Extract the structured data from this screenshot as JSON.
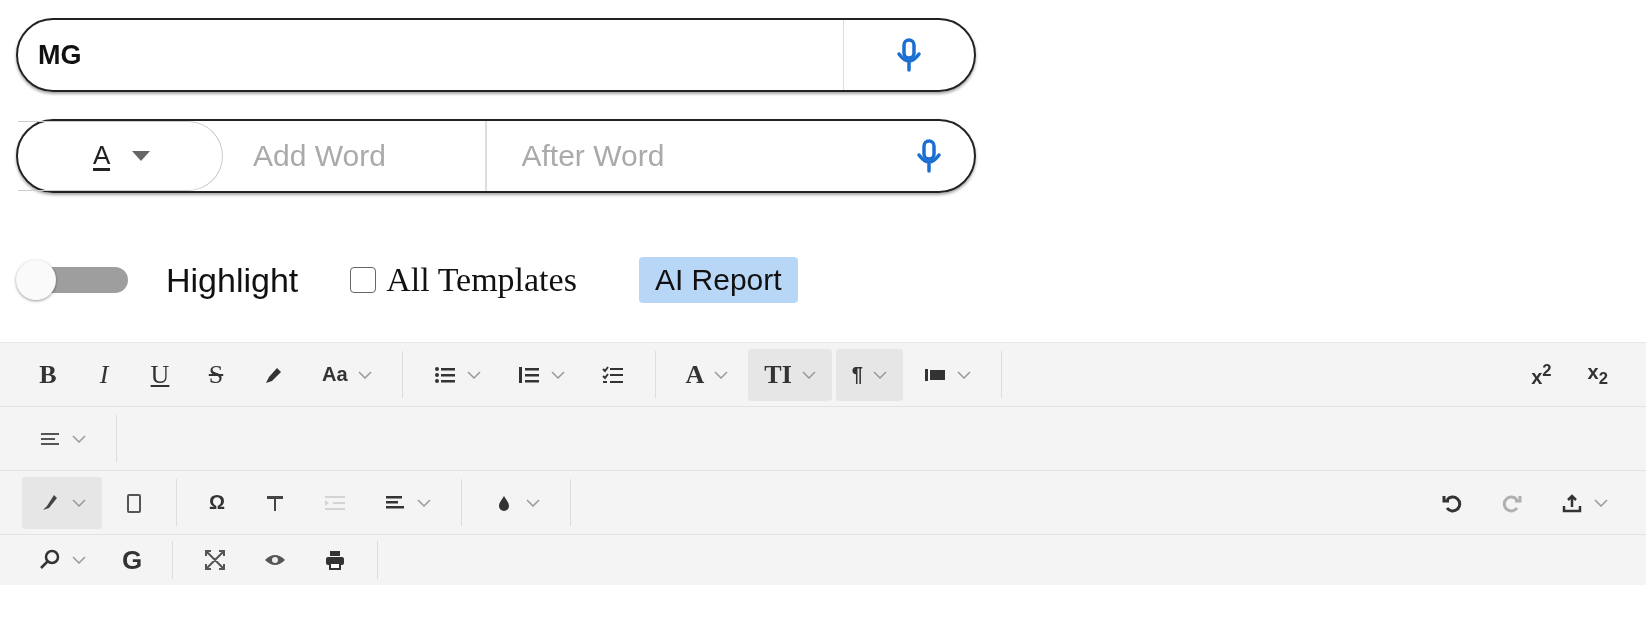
{
  "search_field": {
    "value": "MG"
  },
  "word_field": {
    "font_color_dropdown": {
      "label": "A"
    },
    "add_word": {
      "placeholder": "Add Word"
    },
    "after_word": {
      "placeholder": "After Word"
    }
  },
  "options": {
    "highlight": {
      "label": "Highlight",
      "on": false
    },
    "all_templates": {
      "label": "All Templates",
      "checked": false
    },
    "ai_report": {
      "label": "AI Report"
    }
  },
  "toolbar": {
    "rows": [
      {
        "groups": [
          {
            "pushed_right": false,
            "items": [
              {
                "kind": "bold",
                "label": "B",
                "pressed": false,
                "disabled": false,
                "caret": false
              },
              {
                "kind": "italic",
                "label": "I",
                "pressed": false,
                "disabled": false,
                "caret": false
              },
              {
                "kind": "underline",
                "label": "U",
                "pressed": false,
                "disabled": false,
                "caret": false
              },
              {
                "kind": "strike",
                "label": "S",
                "pressed": false,
                "disabled": false,
                "caret": false
              },
              {
                "kind": "icon",
                "pressed": false,
                "disabled": false,
                "caret": false
              },
              {
                "kind": "text",
                "label": "Aa",
                "pressed": false,
                "disabled": false,
                "caret": true
              }
            ]
          },
          {
            "pushed_right": false,
            "items": [
              {
                "kind": "icon",
                "pressed": false,
                "disabled": false,
                "caret": true
              },
              {
                "kind": "icon",
                "pressed": false,
                "disabled": false,
                "caret": true
              },
              {
                "kind": "icon",
                "pressed": false,
                "disabled": false,
                "caret": false
              }
            ]
          },
          {
            "pushed_right": false,
            "items": [
              {
                "kind": "serif",
                "label": "A",
                "pressed": false,
                "disabled": false,
                "caret": true
              },
              {
                "kind": "serif",
                "label": "TI",
                "pressed": true,
                "disabled": false,
                "caret": true
              },
              {
                "kind": "text",
                "label": "¶",
                "pressed": true,
                "disabled": false,
                "caret": true
              },
              {
                "kind": "icon",
                "pressed": false,
                "disabled": false,
                "caret": true
              }
            ]
          },
          {
            "pushed_right": true,
            "items": [
              {
                "kind": "text",
                "label": "x$^{2}$",
                "pressed": false,
                "disabled": false,
                "caret": false
              },
              {
                "kind": "text",
                "label": "x$_{2}$",
                "pressed": false,
                "disabled": false,
                "caret": false
              }
            ]
          }
        ]
      },
      {
        "groups": [
          {
            "pushed_right": false,
            "items": [
              {
                "kind": "icon",
                "pressed": false,
                "disabled": false,
                "caret": true
              }
            ]
          }
        ]
      },
      {
        "groups": [
          {
            "pushed_right": false,
            "items": [
              {
                "kind": "icon",
                "pressed": true,
                "disabled": false,
                "caret": true
              },
              {
                "kind": "icon",
                "pressed": false,
                "disabled": false,
                "caret": false
              }
            ]
          },
          {
            "pushed_right": false,
            "items": [
              {
                "kind": "text",
                "label": "Ω",
                "pressed": false,
                "disabled": false,
                "caret": false
              },
              {
                "kind": "icon",
                "pressed": false,
                "disabled": false,
                "caret": false
              },
              {
                "kind": "icon",
                "pressed": false,
                "disabled": true,
                "caret": false
              },
              {
                "kind": "icon",
                "pressed": false,
                "disabled": false,
                "caret": true
              }
            ]
          },
          {
            "pushed_right": false,
            "items": [
              {
                "kind": "icon",
                "pressed": false,
                "disabled": false,
                "caret": true
              }
            ]
          },
          {
            "pushed_right": true,
            "items": [
              {
                "kind": "icon",
                "pressed": false,
                "disabled": false,
                "caret": false
              },
              {
                "kind": "icon",
                "pressed": false,
                "disabled": true,
                "caret": false
              },
              {
                "kind": "icon",
                "pressed": false,
                "disabled": false,
                "caret": true
              }
            ]
          }
        ]
      },
      {
        "groups": [
          {
            "pushed_right": false,
            "items": [
              {
                "kind": "icon",
                "pressed": false,
                "disabled": false,
                "caret": true
              },
              {
                "kind": "bold-sans",
                "label": "G",
                "pressed": false,
                "disabled": false,
                "caret": false
              }
            ]
          },
          {
            "pushed_right": false,
            "items": [
              {
                "kind": "icon",
                "pressed": false,
                "disabled": false,
                "caret": false
              },
              {
                "kind": "icon",
                "pressed": false,
                "disabled": false,
                "caret": false
              },
              {
                "kind": "icon",
                "pressed": false,
                "disabled": false,
                "caret": false
              }
            ]
          }
        ]
      }
    ]
  }
}
